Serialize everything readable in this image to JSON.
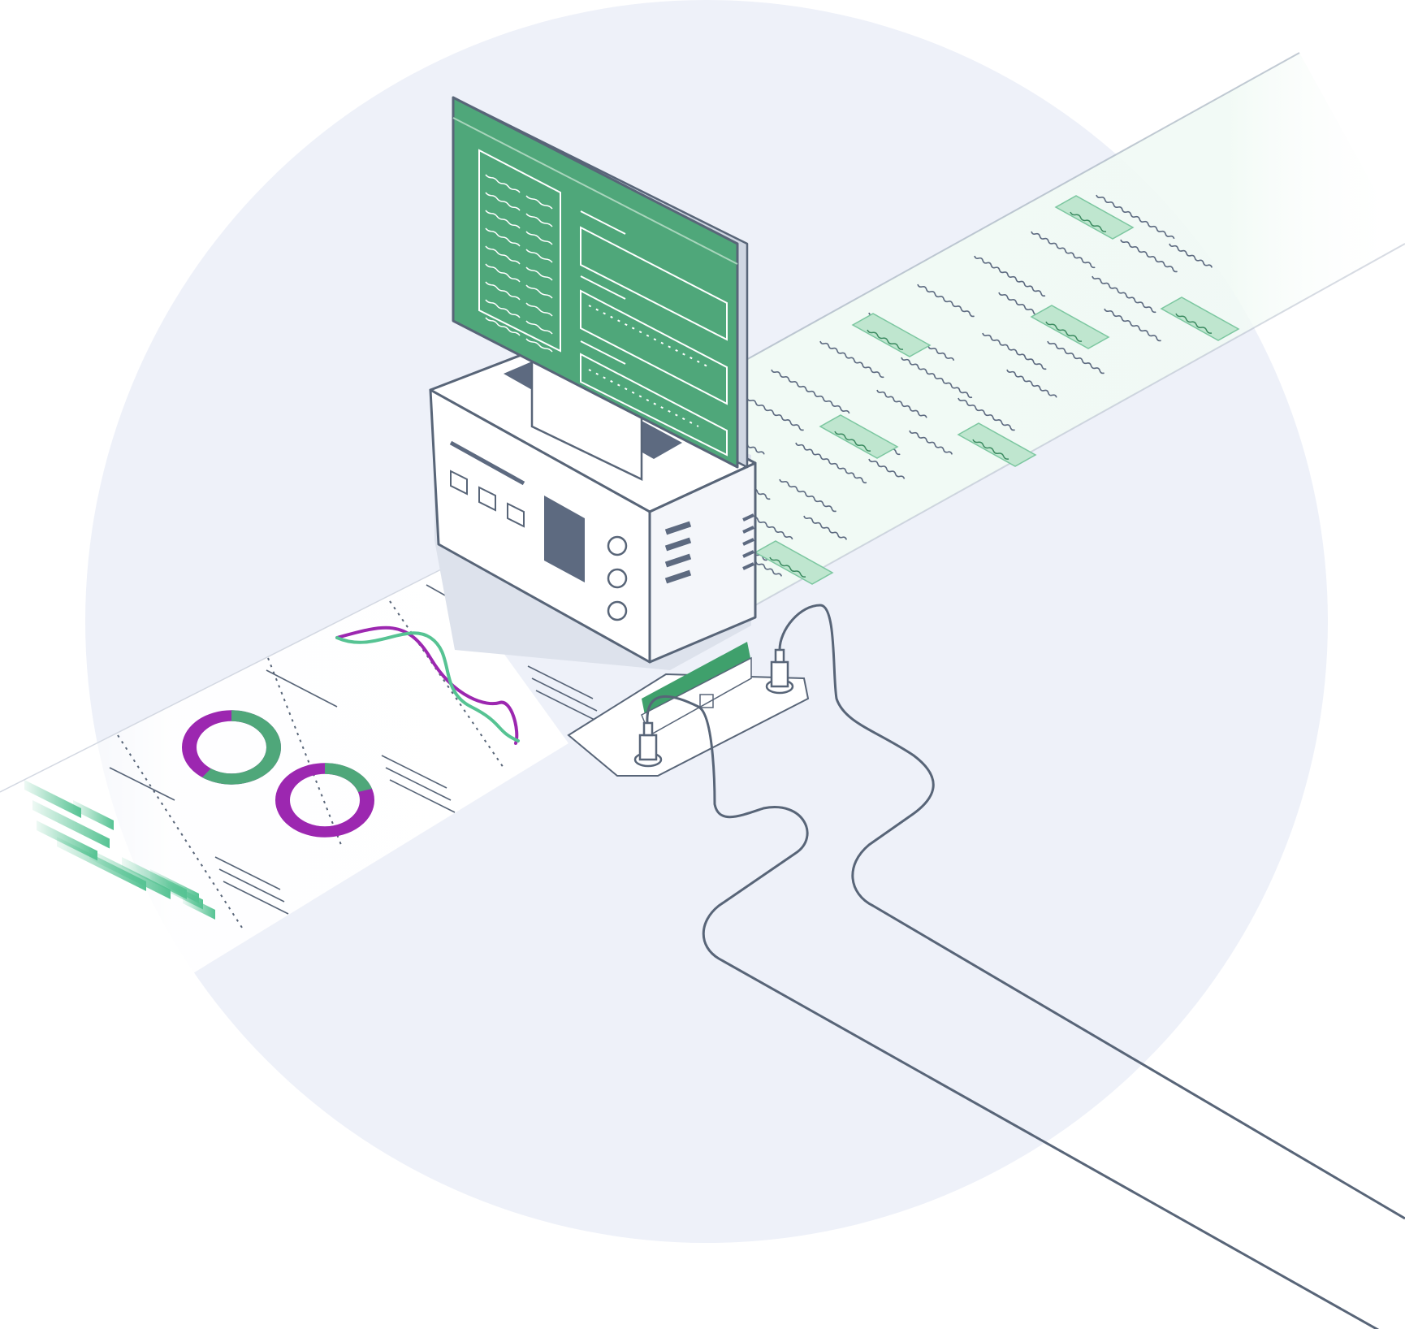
{
  "illustration": {
    "subject": "data-processing-machine",
    "icons": [
      "background-circle-icon",
      "unstructured-text-strip-icon",
      "report-strip-icon",
      "monitor-icon",
      "machine-icon",
      "cable-icon",
      "donut-chart-icon",
      "line-chart-icon",
      "bar-chart-icon"
    ]
  },
  "colors": {
    "background_circle": "#eef1f9",
    "outline": "#586578",
    "screen_green": "#4fa77a",
    "accent_green": "#56c393",
    "highlight_green": "#bfe6cf",
    "accent_purple": "#9c27b0",
    "machine_face": "#ffffff",
    "machine_shadow": "#dde2ec",
    "panel_dark": "#5d6a80"
  },
  "donuts": [
    {
      "green_fraction": 0.6,
      "purple_fraction": 0.4
    },
    {
      "green_fraction": 0.2,
      "purple_fraction": 0.8
    }
  ]
}
